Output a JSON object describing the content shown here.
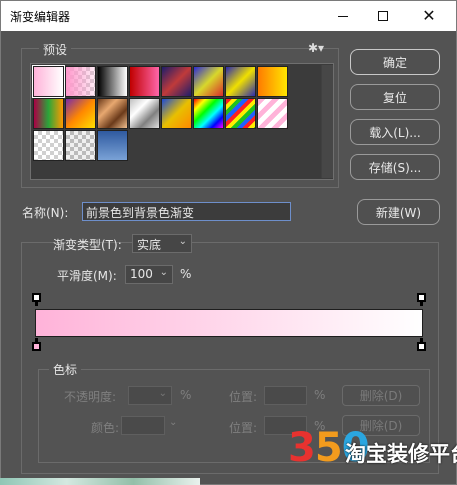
{
  "window": {
    "title": "渐变编辑器"
  },
  "presets": {
    "legend": "预设",
    "gear_icon": "gear-icon",
    "swatches": [
      "linear-gradient(90deg,#ffb3d9,#ffffff)",
      "linear-gradient(90deg,#ff99cc 0%,rgba(255,153,204,0.2) 100%),repeating-conic-gradient(#cfcfcf 0 25%,#ffffff 0 50%) 0 0/8px 8px",
      "linear-gradient(90deg,#000000,#ffffff)",
      "linear-gradient(90deg,#c00000,#ff66aa)",
      "linear-gradient(135deg,#1d1d6b,#c03a3a,#1d1d6b)",
      "linear-gradient(135deg,#2b2bd8,#d8d82b,#d82b2b)",
      "linear-gradient(135deg,#2a2ab0,#f0e000,#2a2ab0)",
      "linear-gradient(90deg,#ff7b00,#ffe600)",
      "linear-gradient(90deg,#aa0044,#2aa63a,#ff9900)",
      "linear-gradient(135deg,#7a2aa8,#ff8800,#ffe000)",
      "linear-gradient(135deg,#6b3a1a,#e8a870,#6b3a1a,#f0c090)",
      "linear-gradient(135deg,#c0c0c0,#ffffff,#808080,#e0e0e0)",
      "linear-gradient(135deg,#1a4ad8,#e8c000,#ff8800)",
      "linear-gradient(135deg,#ff0000,#ffff00,#00ff00,#00ffff,#0000ff,#ff00ff)",
      "repeating-linear-gradient(135deg,#ff2020 0 4px,#ffee00 4px 8px,#20c020 8px 12px,#2060ff 12px 16px)",
      "repeating-linear-gradient(135deg,#ffb3d9 0 5px,#ffffff 5px 10px)",
      "repeating-conic-gradient(#d0d0d0 0 25%,#ffffff 0 50%) 0 0/8px 8px",
      "repeating-conic-gradient(#bbbbbb 0 25%,#f0f0f0 0 50%) 0 0/8px 8px",
      "linear-gradient(180deg,#2f5aa0,#7aa2d6)"
    ]
  },
  "buttons": {
    "ok": "确定",
    "reset": "复位",
    "load": "载入(L)...",
    "save": "存储(S)...",
    "new": "新建(W)",
    "delete_opacity": "删除(D)",
    "delete_color": "删除(D)"
  },
  "name": {
    "label": "名称(N):",
    "value": "前景色到背景色渐变"
  },
  "gradient_type": {
    "label": "渐变类型(T):",
    "value": "实底"
  },
  "smoothness": {
    "label": "平滑度(M):",
    "value": "100",
    "unit": "%"
  },
  "gradient": {
    "start_color": "#ffb3d9",
    "end_color": "#ffffff"
  },
  "stops": {
    "legend": "色标",
    "opacity_label": "不透明度:",
    "opacity_unit": "%",
    "color_label": "颜色:",
    "position_label": "位置:",
    "position_unit": "%"
  },
  "watermark": {
    "number_3": "3",
    "number_5": "5",
    "number_0": "0",
    "text": "淘宝装修平台"
  }
}
